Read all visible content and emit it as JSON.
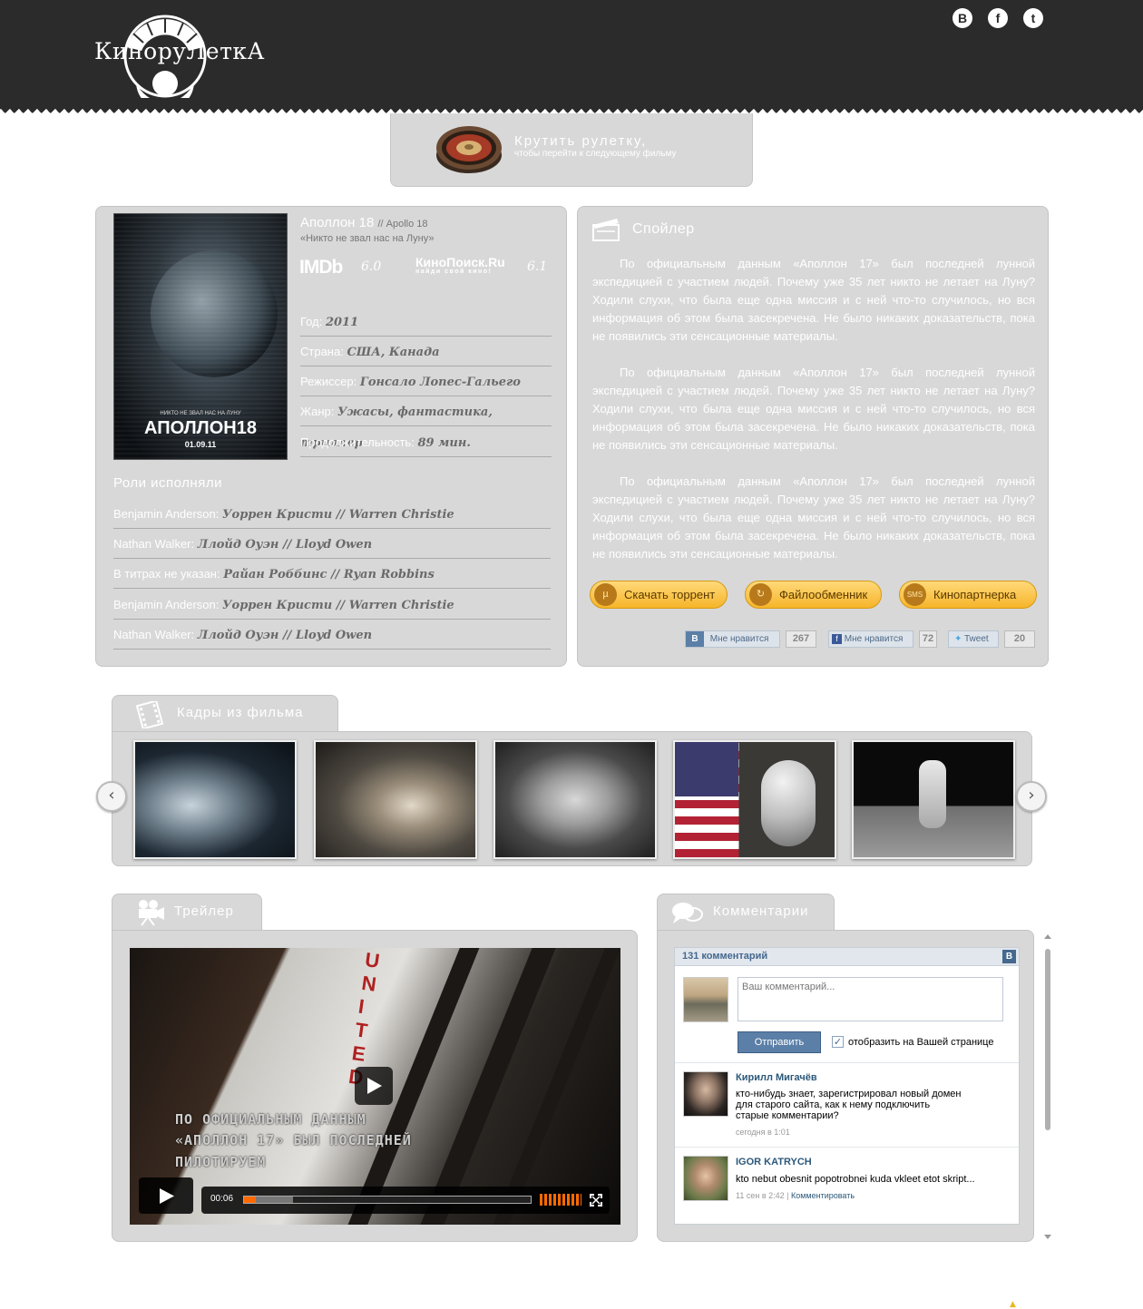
{
  "header": {
    "logo_text": "КиноруЛеткА",
    "social": [
      {
        "name": "vkontakte",
        "glyph": "В"
      },
      {
        "name": "facebook",
        "glyph": "f"
      },
      {
        "name": "twitter",
        "glyph": "t"
      }
    ]
  },
  "roulette": {
    "title": "Крутить рулетку,",
    "subtitle": "чтобы перейти к следующему фильму"
  },
  "movie": {
    "title": "Аполлон 18",
    "original_title": "// Apollo 18",
    "tagline": "«Никто не звал нас на Луну»",
    "poster": {
      "tagline": "НИКТО НЕ ЗВАЛ НАС НА ЛУНУ",
      "title": "АПОЛЛОН18",
      "date": "01.09.11"
    },
    "imdb_label": "IMDb",
    "imdb_score": "6.0",
    "kp_label": "КиноПоиск.Ru",
    "kp_sub": "найди свой кино!",
    "kp_score": "6.1",
    "info": [
      {
        "label": "Год:",
        "value": "2011"
      },
      {
        "label": "Страна:",
        "value": "США, Канада"
      },
      {
        "label": "Режиссер:",
        "value": "Гонсало Лопес-Гальего"
      },
      {
        "label": "Жанр:",
        "value": "Ужасы, фантастика, триллер"
      },
      {
        "label": "Продолжительность:",
        "value": "89 мин."
      }
    ],
    "roles_title": "Роли исполняли",
    "roles": [
      {
        "role": "Benjamin Anderson:",
        "actor": "Уоррен Кристи // Warren Christie"
      },
      {
        "role": "Nathan Walker:",
        "actor": "Ллойд Оуэн // Lloyd Owen"
      },
      {
        "role": "В титрах не указан:",
        "actor": "Райан Роббинс // Ryan Robbins"
      },
      {
        "role": "Benjamin Anderson:",
        "actor": "Уоррен Кристи // Warren Christie"
      },
      {
        "role": "Nathan Walker:",
        "actor": "Ллойд Оуэн // Lloyd Owen"
      }
    ]
  },
  "spoiler": {
    "title": "Спойлер",
    "paragraphs": [
      "По официальным данным «Аполлон 17» был последней лунной экспедицией с участием людей. Почему уже 35 лет никто не летает на Луну? Ходили слухи, что была еще одна миссия и с ней что-то случилось, но вся информация об этом была засекречена. Не было никаких доказательств, пока не появились эти сенсационные материалы.",
      "По официальным данным «Аполлон 17» был последней лунной экспедицией с участием людей. Почему уже 35 лет никто не летает на Луну? Ходили слухи, что была еще одна миссия и с ней что-то случилось, но вся информация об этом была засекречена. Не было никаких доказательств, пока не появились эти сенсационные материалы.",
      "По официальным данным «Аполлон 17» был последней лунной экспедицией с участием людей. Почему уже 35 лет никто не летает на Луну? Ходили слухи, что была еще одна миссия и с ней что-то случилось, но вся информация об этом была засекречена. Не было никаких доказательств, пока не появились эти сенсационные материалы."
    ],
    "buttons": [
      {
        "label": "Скачать торрент",
        "icon": "µ"
      },
      {
        "label": "Файлообменник",
        "icon": "↻"
      },
      {
        "label": "Кинопартнерка",
        "icon": "SMS"
      }
    ],
    "likes": {
      "vk_badge": "В",
      "vk_label": "Мне нравится",
      "vk_count": "267",
      "fb_label": "Мне нравится",
      "fb_count": "72",
      "tw_label": "Tweet",
      "tw_count": "20"
    }
  },
  "frames": {
    "title": "Кадры из фильма",
    "prev": "‹",
    "next": "›"
  },
  "trailer": {
    "title": "Трейлер",
    "subtitles": [
      "ПО ОФИЦИАЛЬНЫМ ДАННЫМ",
      "«АПОЛЛОН 17» БЫЛ ПОСЛЕДНЕЙ",
      "ПИЛОТИРУЕМ"
    ],
    "time": "00:06",
    "played_fraction": 0.04,
    "buffered_fraction": 0.17
  },
  "comments": {
    "title": "Комментарии",
    "count": "131 комментарий",
    "badge": "В",
    "placeholder": "Ваш комментарий...",
    "send_label": "Отправить",
    "checkbox_label": "отобразить на Вашей странице",
    "items": [
      {
        "name": "Кирилл Мигачёв",
        "lines": [
          "кто-нибудь знает, зарегистрировал новый домен",
          "для старого сайта, как к  нему подключить",
          "старые комментарии?"
        ],
        "meta": "сегодня в 1:01",
        "reply": ""
      },
      {
        "name": "IGOR KATRYCH",
        "lines": [
          "kto nebut obesnit popotrobnei kuda vkleet etot skript..."
        ],
        "meta": "11 сен в 2:42",
        "reply": "Комментировать"
      }
    ]
  }
}
